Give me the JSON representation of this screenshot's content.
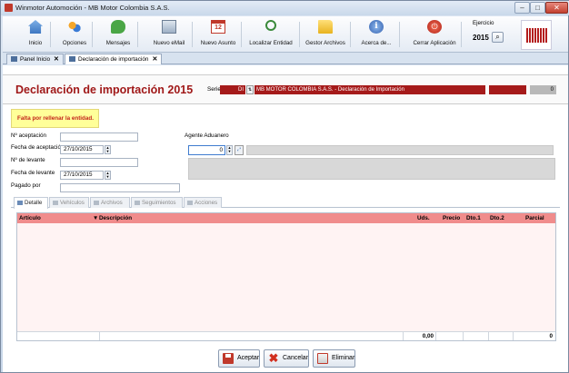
{
  "window": {
    "title": "Winmotor Automoción - MB Motor Colombia S.A.S."
  },
  "toolbar": {
    "items": [
      {
        "label": "Inicio",
        "icon": "home-icon"
      },
      {
        "label": "Opciones",
        "icon": "options-icon"
      },
      {
        "label": "Mensajes",
        "icon": "messages-icon"
      },
      {
        "label": "Nuevo eMail",
        "icon": "email-icon"
      },
      {
        "label": "Nuevo Asunto",
        "icon": "calendar-icon"
      },
      {
        "label": "Localizar Entidad",
        "icon": "search-icon"
      },
      {
        "label": "Gestor Archivos",
        "icon": "folder-icon"
      },
      {
        "label": "Acerca de...",
        "icon": "info-icon"
      },
      {
        "label": "Cerrar Aplicación",
        "icon": "power-icon"
      }
    ],
    "calendar_day": "12",
    "ejercicio_label": "Ejercicio",
    "ejercicio_value": "2015"
  },
  "tabs": [
    {
      "label": "Panel Inicio"
    },
    {
      "label": "Declaración de importación"
    }
  ],
  "header": {
    "title": "Declaración de importación 2015",
    "serie_label": "Serie",
    "serie_value": "DI",
    "entity_text": "MB MOTOR COLOMBIA S.A.S. - Declaración de Importación",
    "number_value": "0"
  },
  "warning": "Falta por rellenar la entidad.",
  "form": {
    "aceptacion_label": "Nº aceptación",
    "aceptacion_value": "",
    "fecha_aceptacion_label": "Fecha de aceptación",
    "fecha_aceptacion_value": "27/10/2015",
    "levante_label": "Nº de levante",
    "levante_value": "",
    "fecha_levante_label": "Fecha de levante",
    "fecha_levante_value": "27/10/2015",
    "pagado_label": "Pagado por",
    "pagado_value": "",
    "agente_label": "Agente Aduanero",
    "agente_value": "0"
  },
  "detail_tabs": [
    "Detalle",
    "Vehículos",
    "Archivos",
    "Seguimientos",
    "Acciones"
  ],
  "grid": {
    "columns": [
      "Artículo",
      "Descripción",
      "Uds.",
      "Precio",
      "Dto.1",
      "Dto.2",
      "Parcial"
    ],
    "footer_uds": "0,00",
    "footer_parcial": "0"
  },
  "buttons": {
    "accept": "Aceptar",
    "cancel": "Cancelar",
    "delete": "Eliminar"
  },
  "colors": {
    "accent_red": "#a51a1a",
    "grid_header": "#f08c8c",
    "warning_bg": "#ffff99"
  }
}
